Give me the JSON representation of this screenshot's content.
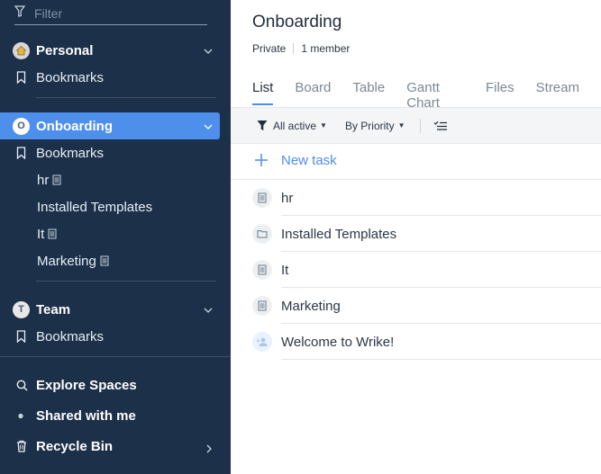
{
  "sidebar": {
    "filter_placeholder": "Filter",
    "spaces": [
      {
        "avatar": "",
        "name": "Personal",
        "bookmarks": "Bookmarks"
      },
      {
        "avatar": "O",
        "name": "Onboarding",
        "bookmarks": "Bookmarks",
        "items": [
          {
            "label": "hr",
            "doc_icon": true
          },
          {
            "label": "Installed Templates",
            "doc_icon": false
          },
          {
            "label": "It",
            "doc_icon": true
          },
          {
            "label": "Marketing",
            "doc_icon": true
          }
        ]
      },
      {
        "avatar": "T",
        "name": "Team",
        "bookmarks": "Bookmarks"
      }
    ],
    "footer": {
      "explore": "Explore Spaces",
      "shared": "Shared with me",
      "recycle": "Recycle Bin"
    },
    "colors": {
      "background": "#1c3149",
      "active": "#4d8fea"
    }
  },
  "main": {
    "title": "Onboarding",
    "privacy": "Private",
    "members": "1 member",
    "tabs": [
      "List",
      "Board",
      "Table",
      "Gantt Chart",
      "Files",
      "Stream"
    ],
    "active_tab": "List",
    "toolbar": {
      "status_filter": "All active",
      "sort": "By Priority"
    },
    "new_task": "New task",
    "rows": [
      {
        "label": "hr",
        "icon": "document-icon"
      },
      {
        "label": "Installed Templates",
        "icon": "folder-icon"
      },
      {
        "label": "It",
        "icon": "document-icon"
      },
      {
        "label": "Marketing",
        "icon": "document-icon"
      },
      {
        "label": "Welcome to Wrike!",
        "icon": "add-user-icon"
      }
    ]
  }
}
